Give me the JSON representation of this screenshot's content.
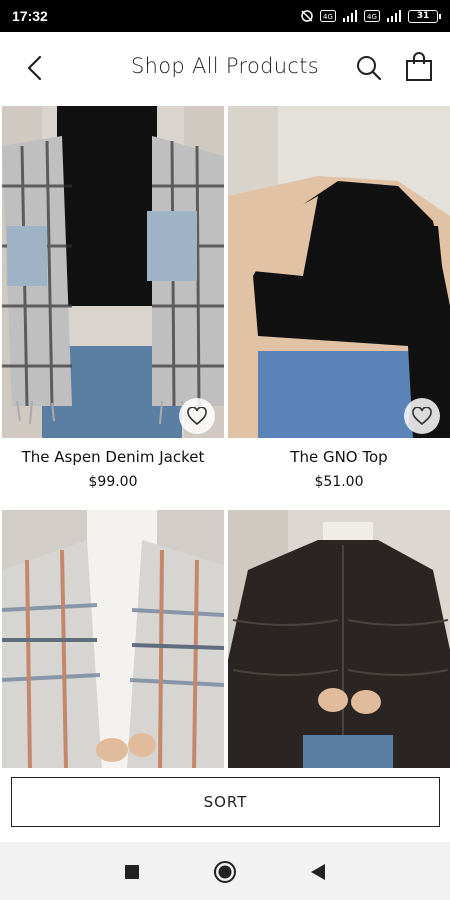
{
  "status_bar": {
    "time": "17:32",
    "battery": "31",
    "icons": [
      "alarm-off-icon",
      "volte-icon",
      "signal-icon",
      "volte-icon",
      "signal-icon",
      "battery-icon"
    ]
  },
  "header": {
    "title": "Shop All Products",
    "icons": [
      "back-arrow-icon",
      "search-icon",
      "shopping-bag-icon"
    ]
  },
  "products": [
    {
      "name": "The Aspen Denim Jacket",
      "price": "$99.00",
      "favorite_icon": "heart-outline-icon"
    },
    {
      "name": "The GNO Top",
      "price": "$51.00",
      "favorite_icon": "heart-outline-icon"
    },
    {
      "name": "",
      "price": ""
    },
    {
      "name": "",
      "price": ""
    }
  ],
  "sort": {
    "label": "SORT"
  },
  "nav": {
    "icons": [
      "recents-square-icon",
      "home-circle-icon",
      "back-triangle-icon"
    ]
  },
  "colors": {
    "accent": "#111111",
    "background": "#ffffff",
    "status_bar": "#000000",
    "nav_bar": "#f2f2f2"
  }
}
